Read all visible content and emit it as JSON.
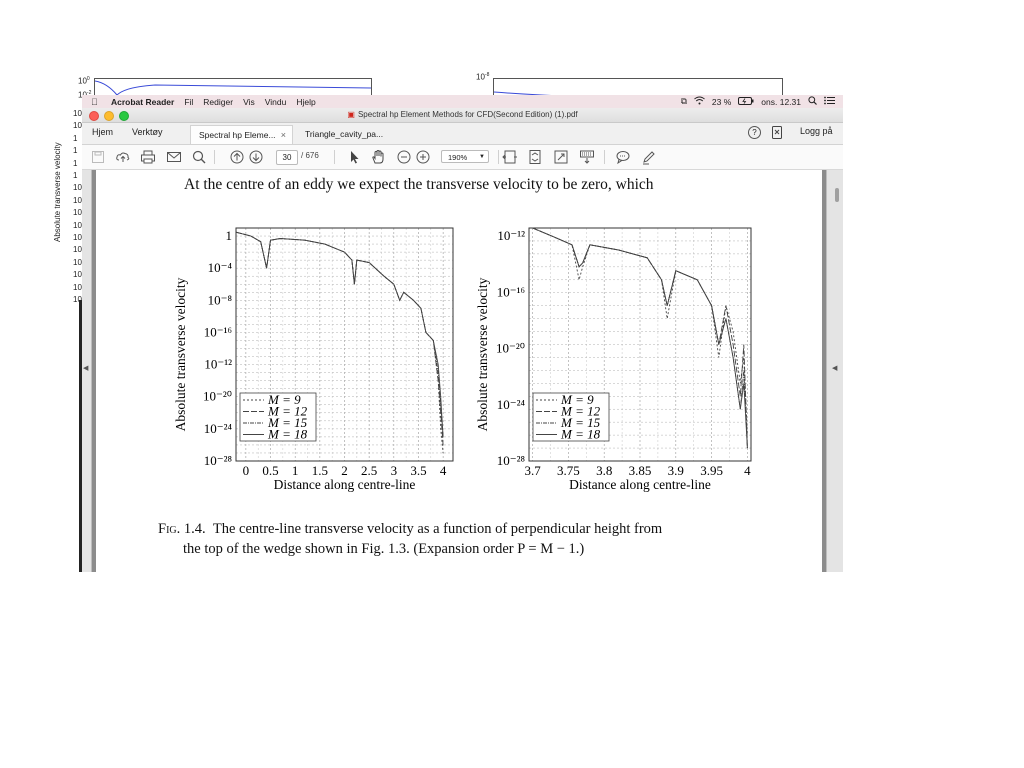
{
  "background": {
    "ylabel": "Absolute transverse velocity",
    "left_ticks": [
      "10",
      "10",
      "1",
      "1",
      "1",
      "1",
      "10",
      "10",
      "10",
      "10",
      "10",
      "10",
      "10",
      "10",
      "10",
      "10"
    ],
    "left_top_tick": "10",
    "left_top_exp": "0",
    "left_second_tick": "10",
    "left_second_exp": "-2",
    "right_top_tick": "10",
    "right_top_exp": "-8"
  },
  "menubar": {
    "app_name": "Acrobat Reader",
    "items": [
      "Fil",
      "Rediger",
      "Vis",
      "Vindu",
      "Hjelp"
    ],
    "battery": "23 %",
    "clock": "ons. 12.31"
  },
  "window": {
    "title": "Spectral hp Element Methods for CFD(Second Edition) (1).pdf"
  },
  "tabs": {
    "home": "Hjem",
    "tools": "Verktøy",
    "doc_tabs": [
      {
        "label": "Spectral hp Eleme...",
        "closable": "×"
      },
      {
        "label": "Triangle_cavity_pa..."
      }
    ],
    "help": "?",
    "login": "Logg på"
  },
  "toolbar": {
    "page_current": "30",
    "page_total": "/  676",
    "zoom": "190%"
  },
  "document": {
    "body_line": "At the centre of an eddy we expect the transverse velocity to be zero, which",
    "caption_label": "Fig. 1.4.",
    "caption_line1": "The centre-line transverse velocity as a function of perpendicular height from",
    "caption_line2": "the top of the wedge shown in Fig. 1.3. (Expansion order P = M − 1.)"
  },
  "chart_data": [
    {
      "type": "line",
      "title": "",
      "xlabel": "Distance along centre-line",
      "ylabel": "Absolute transverse velocity",
      "xlim": [
        -0.2,
        4.2
      ],
      "yscale": "log",
      "ylim": [
        1e-28,
        10
      ],
      "x_ticks": [
        "0",
        "0.5",
        "1",
        "1.5",
        "2",
        "2.5",
        "3",
        "3.5",
        "4"
      ],
      "y_ticks": [
        "1",
        "10⁻⁴",
        "10⁻⁸",
        "10⁻¹⁶",
        "10⁻¹²",
        "10⁻²⁰",
        "10⁻²⁴",
        "10⁻²⁸"
      ],
      "grid": true,
      "legend": "bottom-left",
      "series": [
        {
          "name": "M = 9",
          "dash": "2,2",
          "x": [
            -0.2,
            0.1,
            0.3,
            0.42,
            0.5,
            0.7,
            1.2,
            1.6,
            2.0,
            2.15,
            2.2,
            2.25,
            2.5,
            2.8,
            3.0,
            3.12,
            3.2,
            3.4,
            3.55,
            3.65,
            3.8,
            3.9,
            3.95,
            4.0
          ],
          "y": [
            3,
            1,
            0.2,
            0.0001,
            0.3,
            0.5,
            0.3,
            0.1,
            0.01,
            0.001,
            1e-06,
            0.001,
            0.0005,
            1e-05,
            1e-06,
            1e-08,
            1e-07,
            1e-08,
            1e-09,
            1e-12,
            1e-13,
            1e-18,
            1e-24,
            1e-27
          ]
        },
        {
          "name": "M = 12",
          "dash": "6,2",
          "x": [
            -0.2,
            0.1,
            0.3,
            0.42,
            0.5,
            0.7,
            1.2,
            1.6,
            2.0,
            2.15,
            2.2,
            2.25,
            2.5,
            2.8,
            3.0,
            3.12,
            3.2,
            3.4,
            3.55,
            3.65,
            3.8,
            3.9,
            3.95,
            4.0
          ],
          "y": [
            3,
            1,
            0.2,
            0.0001,
            0.3,
            0.5,
            0.3,
            0.1,
            0.01,
            0.001,
            1e-06,
            0.001,
            0.0005,
            1e-05,
            1e-06,
            1e-08,
            1e-07,
            1e-08,
            1e-09,
            1e-12,
            1e-13,
            1e-18,
            1e-22,
            1e-26
          ]
        },
        {
          "name": "M = 15",
          "dash": "4,1,1,1",
          "x": [
            -0.2,
            0.1,
            0.3,
            0.42,
            0.5,
            0.7,
            1.2,
            1.6,
            2.0,
            2.15,
            2.2,
            2.25,
            2.5,
            2.8,
            3.0,
            3.12,
            3.2,
            3.4,
            3.55,
            3.65,
            3.8,
            3.9,
            3.95,
            4.0
          ],
          "y": [
            3,
            1,
            0.2,
            0.0001,
            0.3,
            0.5,
            0.3,
            0.1,
            0.01,
            0.001,
            1e-06,
            0.001,
            0.0005,
            1e-05,
            1e-06,
            1e-08,
            1e-07,
            1e-08,
            1e-09,
            1e-12,
            1e-13,
            1e-17,
            1e-21,
            1e-25
          ]
        },
        {
          "name": "M = 18",
          "dash": "",
          "x": [
            -0.2,
            0.1,
            0.3,
            0.42,
            0.5,
            0.7,
            1.2,
            1.6,
            2.0,
            2.15,
            2.2,
            2.25,
            2.5,
            2.8,
            3.0,
            3.12,
            3.2,
            3.4,
            3.55,
            3.65,
            3.8,
            3.9,
            3.95,
            4.0
          ],
          "y": [
            3,
            1,
            0.2,
            0.0001,
            0.3,
            0.5,
            0.3,
            0.1,
            0.01,
            0.001,
            1e-06,
            0.001,
            0.0005,
            1e-05,
            1e-06,
            1e-08,
            1e-07,
            1e-08,
            1e-09,
            1e-12,
            1e-13,
            1e-16,
            1e-20,
            1e-25
          ]
        }
      ]
    },
    {
      "type": "line",
      "title": "",
      "xlabel": "Distance along centre-line",
      "ylabel": "Absolute transverse velocity",
      "xlim": [
        3.695,
        4.005
      ],
      "yscale": "log",
      "ylim": [
        1e-28,
        1e-10
      ],
      "x_ticks": [
        "3.7",
        "3.75",
        "3.8",
        "3.85",
        "3.9",
        "3.95",
        "4"
      ],
      "y_ticks": [
        "10⁻¹²",
        "10⁻¹⁶",
        "10⁻²⁰",
        "10⁻²⁴",
        "10⁻²⁸"
      ],
      "grid": true,
      "legend": "bottom-left",
      "series": [
        {
          "name": "M = 9",
          "dash": "2,2",
          "x": [
            3.7,
            3.73,
            3.755,
            3.765,
            3.77,
            3.78,
            3.82,
            3.86,
            3.88,
            3.888,
            3.9,
            3.93,
            3.95,
            3.96,
            3.97,
            3.98,
            3.99,
            3.995,
            4.0
          ],
          "y": [
            1e-10,
            2e-11,
            5e-12,
            1e-14,
            1e-13,
            5e-12,
            2e-12,
            5e-13,
            1e-14,
            1e-17,
            5e-14,
            1e-14,
            1e-16,
            1e-20,
            1e-16,
            1e-18,
            1e-22,
            1e-20,
            1e-26
          ]
        },
        {
          "name": "M = 12",
          "dash": "6,2",
          "x": [
            3.7,
            3.73,
            3.755,
            3.765,
            3.77,
            3.78,
            3.82,
            3.86,
            3.88,
            3.888,
            3.9,
            3.93,
            3.95,
            3.96,
            3.97,
            3.98,
            3.99,
            3.995,
            4.0
          ],
          "y": [
            1e-10,
            2e-11,
            5e-12,
            1e-13,
            2e-13,
            5e-12,
            2e-12,
            5e-13,
            1e-14,
            1e-16,
            5e-14,
            1e-14,
            1e-16,
            1e-19,
            1e-16,
            1e-19,
            1e-23,
            1e-19,
            1e-27
          ]
        },
        {
          "name": "M = 15",
          "dash": "4,1,1,1",
          "x": [
            3.7,
            3.73,
            3.755,
            3.765,
            3.77,
            3.78,
            3.82,
            3.86,
            3.88,
            3.888,
            3.9,
            3.93,
            3.95,
            3.96,
            3.97,
            3.98,
            3.99,
            3.995,
            4.0
          ],
          "y": [
            1e-10,
            2e-11,
            5e-12,
            1e-13,
            2e-13,
            5e-12,
            2e-12,
            5e-13,
            1e-14,
            1e-16,
            5e-14,
            1e-14,
            1e-16,
            1e-19,
            1e-17,
            1e-20,
            1e-24,
            1e-21,
            1e-27
          ]
        },
        {
          "name": "M = 18",
          "dash": "",
          "x": [
            3.7,
            3.73,
            3.755,
            3.765,
            3.77,
            3.78,
            3.82,
            3.86,
            3.88,
            3.888,
            3.9,
            3.93,
            3.95,
            3.96,
            3.97,
            3.98,
            3.99,
            3.995,
            4.0
          ],
          "y": [
            1e-10,
            2e-11,
            5e-12,
            1e-13,
            2e-13,
            5e-12,
            2e-12,
            5e-13,
            1e-14,
            1e-16,
            5e-14,
            1e-14,
            1e-16,
            1e-19,
            1e-17,
            1e-20,
            1e-24,
            1e-22,
            1e-27
          ]
        }
      ]
    }
  ]
}
